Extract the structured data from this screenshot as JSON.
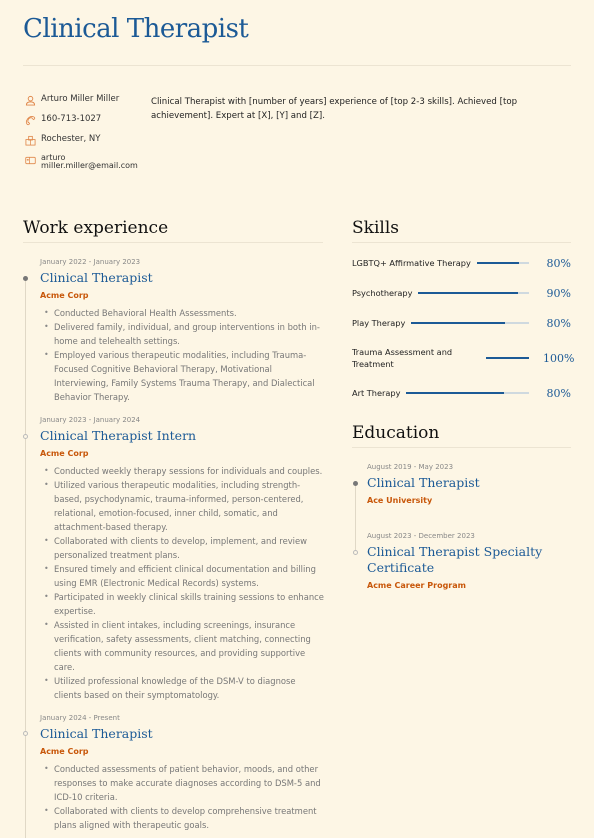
{
  "header": {
    "title": "Clinical Therapist"
  },
  "contact": {
    "name": "Arturo Miller Miller",
    "phone": "160-713-1027",
    "location": "Rochester, NY",
    "email_line1": "arturo",
    "email_line2": "miller.miller@email.com",
    "icons": [
      "person-icon",
      "phone-icon",
      "building-icon",
      "mailbox-icon"
    ]
  },
  "summary": "Clinical Therapist with [number of years] experience of [top 2-3 skills]. Achieved [top achievement]. Expert at [X], [Y] and [Z].",
  "work": {
    "heading": "Work experience",
    "jobs": [
      {
        "date": "January 2022 - January 2023",
        "title": "Clinical Therapist",
        "company": "Acme Corp",
        "bullets": [
          "Conducted Behavioral Health Assessments.",
          "Delivered family, individual, and group interventions in both in-home and telehealth settings.",
          "Employed various therapeutic modalities, including Trauma-Focused Cognitive Behavioral Therapy, Motivational Interviewing, Family Systems Trauma Therapy, and Dialectical Behavior Therapy."
        ]
      },
      {
        "date": "January 2023 - January 2024",
        "title": "Clinical Therapist Intern",
        "company": "Acme Corp",
        "bullets": [
          "Conducted weekly therapy sessions for individuals and couples.",
          "Utilized various therapeutic modalities, including strength-based, psychodynamic, trauma-informed, person-centered, relational, emotion-focused, inner child, somatic, and attachment-based therapy.",
          "Collaborated with clients to develop, implement, and review personalized treatment plans.",
          "Ensured timely and efficient clinical documentation and billing using EMR (Electronic Medical Records) systems.",
          "Participated in weekly clinical skills training sessions to enhance expertise.",
          "Assisted in client intakes, including screenings, insurance verification, safety assessments, client matching, connecting clients with community resources, and providing supportive care.",
          "Utilized professional knowledge of the DSM-V to diagnose clients based on their symptomatology."
        ]
      },
      {
        "date": "January 2024 - Present",
        "title": "Clinical Therapist",
        "company": "Acme Corp",
        "bullets": [
          "Conducted assessments of patient behavior, moods, and other responses to make accurate diagnoses according to DSM-5 and ICD-10 criteria.",
          "Collaborated with clients to develop comprehensive treatment plans aligned with therapeutic goals."
        ]
      }
    ]
  },
  "skills": {
    "heading": "Skills",
    "items": [
      {
        "name": "LGBTQ+ Affirmative Therapy",
        "level": 80,
        "label": "80%"
      },
      {
        "name": "Psychotherapy",
        "level": 90,
        "label": "90%"
      },
      {
        "name": "Play Therapy",
        "level": 80,
        "label": "80%"
      },
      {
        "name": "Trauma Assessment and Treatment",
        "level": 100,
        "label": "100%"
      },
      {
        "name": "Art Therapy",
        "level": 80,
        "label": "80%"
      }
    ]
  },
  "education": {
    "heading": "Education",
    "items": [
      {
        "date": "August 2019 - May 2023",
        "title": "Clinical Therapist",
        "institution": "Ace University"
      },
      {
        "date": "August 2023 - December 2023",
        "title": "Clinical Therapist Specialty Certificate",
        "institution": "Acme Career Program"
      }
    ]
  },
  "colors": {
    "accent": "#1c5a96",
    "company": "#c8570a",
    "icon": "#e0874a",
    "background": "#fdf6e5"
  }
}
